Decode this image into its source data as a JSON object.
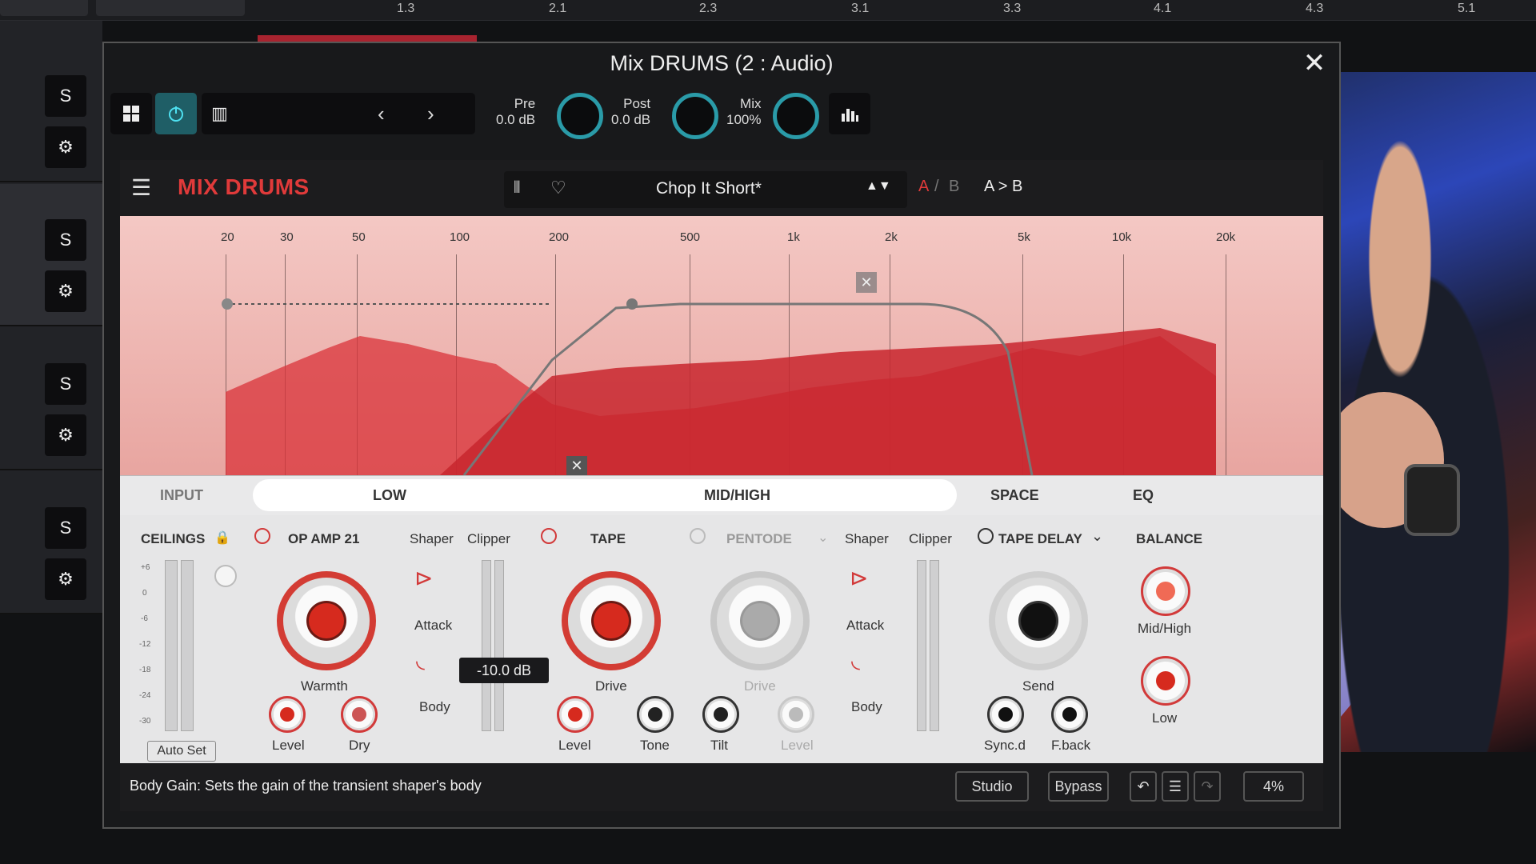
{
  "ruler": {
    "ticks": [
      "1.3",
      "2.1",
      "2.3",
      "3.1",
      "3.3",
      "4.1",
      "4.3",
      "5.1"
    ]
  },
  "tracks": [
    {
      "solo": "S",
      "settings_icon": "gear-icon"
    },
    {
      "solo": "S",
      "settings_icon": "gear-icon"
    },
    {
      "solo": "S",
      "settings_icon": "gear-icon"
    },
    {
      "solo": "S",
      "settings_icon": "gear-icon"
    }
  ],
  "window": {
    "title": "Mix DRUMS (2 : Audio)",
    "close_glyph": "✕"
  },
  "host_toolbar": {
    "pre_label": "Pre",
    "pre_value": "0.0 dB",
    "post_label": "Post",
    "post_value": "0.0 dB",
    "mix_label": "Mix",
    "mix_value": "100%",
    "prev_glyph": "‹",
    "next_glyph": "›"
  },
  "plugin": {
    "brand": "MIX DRUMS",
    "preset_name": "Chop It Short*",
    "ab_a": "A",
    "ab_sep": "/",
    "ab_b": "B",
    "ab_copy": "A > B",
    "freq_labels": [
      "20",
      "30",
      "50",
      "100",
      "200",
      "500",
      "1k",
      "2k",
      "5k",
      "10k",
      "20k"
    ],
    "tabs": {
      "input": "INPUT",
      "low": "LOW",
      "midhigh": "MID/HIGH",
      "space": "SPACE",
      "eq": "EQ"
    },
    "input": {
      "title": "CEILINGS",
      "autoset": "Auto Set",
      "scale": [
        "+6",
        "0",
        "-6",
        "-12",
        "-18",
        "-24",
        "-30"
      ]
    },
    "opamp": {
      "title": "OP AMP 21",
      "shaper": "Shaper",
      "clipper": "Clipper",
      "warmth": "Warmth",
      "attack": "Attack",
      "body": "Body",
      "level": "Level",
      "dry": "Dry"
    },
    "tape": {
      "title": "TAPE",
      "drive": "Drive",
      "level": "Level",
      "tone": "Tone",
      "tilt": "Tilt"
    },
    "pentode": {
      "title": "PENTODE",
      "shaper": "Shaper",
      "clipper": "Clipper",
      "drive": "Drive",
      "attack": "Attack",
      "body": "Body",
      "level": "Level"
    },
    "delay": {
      "title": "TAPE DELAY",
      "send": "Send",
      "sync": "Sync.d",
      "fback": "F.back"
    },
    "balance": {
      "title": "BALANCE",
      "midhigh": "Mid/High",
      "low": "Low"
    },
    "tooltip": "-10.0 dB",
    "status_text": "Body Gain: Sets the gain of the transient shaper's body",
    "studio": "Studio",
    "bypass": "Bypass",
    "zoom": "4%"
  }
}
